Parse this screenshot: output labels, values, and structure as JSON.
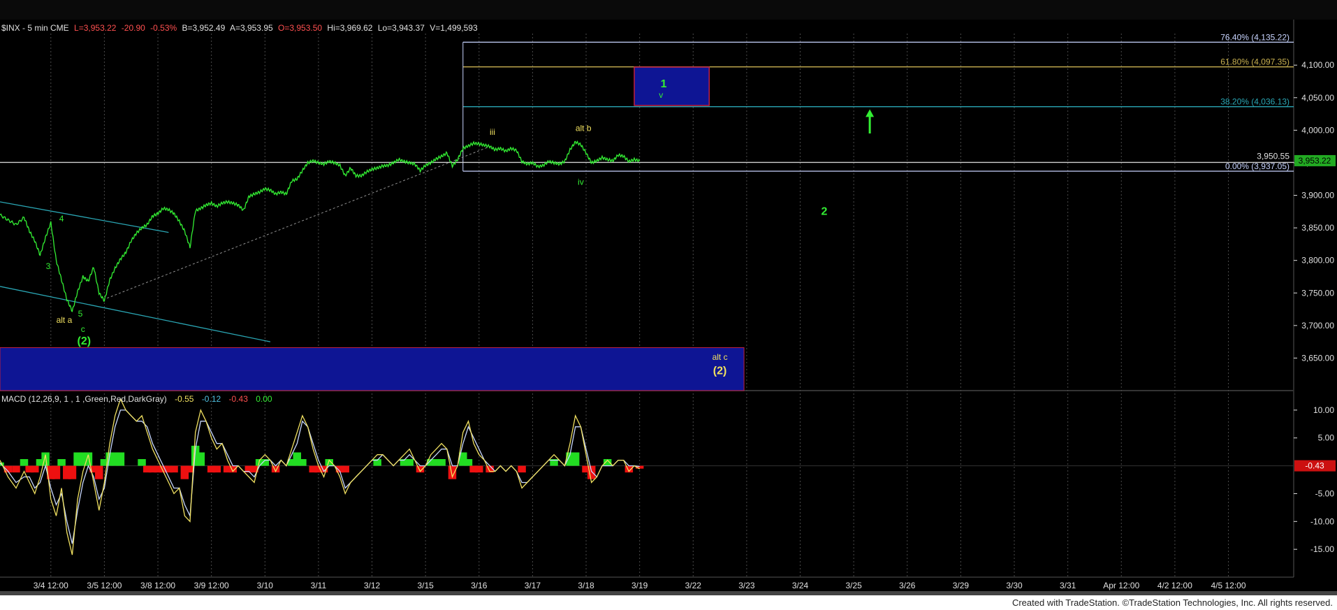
{
  "header": {
    "symbol": "$INX - 5 min  CME",
    "last": "L=3,953.22",
    "change": "-20.90",
    "pct": "-0.53%",
    "bid": "B=3,952.49",
    "ask": "A=3,953.95",
    "open": "O=3,953.50",
    "high": "Hi=3,969.62",
    "low": "Lo=3,943.37",
    "volume": "V=1,499,593"
  },
  "macd_header": {
    "name": "MACD (12,26,9, 1 , 1 ,Green,Red,DarkGray)",
    "v1": "-0.55",
    "v2": "-0.12",
    "v3": "-0.43",
    "v4": "0.00"
  },
  "footer": {
    "text": "Created with TradeStation. ©TradeStation Technologies, Inc. All rights reserved."
  },
  "colors": {
    "price": "#33ee33",
    "yellow": "#f0e060",
    "teal": "#2aa6b4",
    "navy": "#0e1594",
    "grid": "#4a4a4a",
    "axis": "#e0e0e0"
  },
  "chart_data": [
    {
      "type": "line",
      "title": "$INX - 5 min",
      "ylim": [
        3600,
        4170
      ],
      "y_ticks": [
        "4,100.00",
        "4,050.00",
        "4,000.00",
        "3,950.00",
        "3,900.00",
        "3,850.00",
        "3,800.00",
        "3,750.00",
        "3,700.00",
        "3,650.00"
      ],
      "y_tick_values": [
        4100,
        4050,
        4000,
        3950,
        3900,
        3850,
        3800,
        3750,
        3700,
        3650
      ],
      "x_ticks": [
        "3/4 12:00",
        "3/5 12:00",
        "3/8 12:00",
        "3/9 12:00",
        "3/10",
        "3/11",
        "3/12",
        "3/15",
        "3/16",
        "3/17",
        "3/18",
        "3/19",
        "3/22",
        "3/23",
        "3/24",
        "3/25",
        "3/26",
        "3/29",
        "3/30",
        "3/31",
        "Apr 12:00",
        "4/2 12:00",
        "4/5 12:00"
      ],
      "x_tick_pos": [
        0.5,
        1.5,
        2.5,
        3.5,
        4.5,
        5.5,
        6.5,
        7.5,
        8.5,
        9.5,
        10.5,
        11.5,
        12.5,
        13.5,
        14.5,
        15.5,
        16.5,
        17.5,
        18.5,
        19.5,
        20.5,
        21.5,
        22.5
      ],
      "x_domain": [
        -0.45,
        23.72
      ],
      "series": [
        {
          "x": [
            -0.45,
            -0.3,
            -0.15,
            0.0,
            0.1,
            0.2,
            0.3,
            0.4,
            0.5,
            0.6,
            0.7,
            0.8,
            0.9,
            1.0,
            1.1,
            1.2,
            1.3,
            1.4,
            1.5,
            1.6,
            1.7,
            1.8,
            1.9,
            2.0,
            2.1,
            2.2,
            2.3,
            2.4,
            2.5,
            2.6,
            2.7,
            2.8,
            2.9,
            3.0,
            3.1,
            3.2,
            3.3,
            3.4,
            3.5,
            3.6,
            3.7,
            3.8,
            3.9,
            4.0,
            4.1,
            4.2,
            4.3,
            4.4,
            4.5,
            4.6,
            4.7,
            4.8,
            4.9,
            5.0,
            5.1,
            5.2,
            5.3,
            5.4,
            5.5,
            5.6,
            5.7,
            5.8,
            5.9,
            6.0,
            6.1,
            6.2,
            6.3,
            6.4,
            6.5,
            6.6,
            6.7,
            6.8,
            6.9,
            7.0,
            7.1,
            7.2,
            7.3,
            7.4,
            7.5,
            7.6,
            7.7,
            7.8,
            7.9,
            8.0,
            8.1,
            8.2,
            8.3,
            8.4,
            8.5,
            8.6,
            8.7,
            8.8,
            8.9,
            9.0,
            9.1,
            9.2,
            9.3,
            9.4,
            9.5,
            9.6,
            9.7,
            9.8,
            9.9,
            10.0,
            10.1,
            10.2,
            10.3,
            10.4,
            10.5,
            10.6,
            10.7,
            10.8,
            10.9,
            11.0,
            11.1,
            11.2,
            11.3,
            11.4,
            11.5
          ],
          "y": [
            3870,
            3862,
            3855,
            3866,
            3845,
            3830,
            3808,
            3835,
            3858,
            3800,
            3770,
            3740,
            3722,
            3752,
            3775,
            3768,
            3790,
            3750,
            3738,
            3770,
            3788,
            3802,
            3812,
            3830,
            3842,
            3850,
            3855,
            3868,
            3872,
            3880,
            3878,
            3872,
            3860,
            3845,
            3820,
            3876,
            3880,
            3885,
            3888,
            3883,
            3888,
            3890,
            3888,
            3885,
            3877,
            3898,
            3902,
            3905,
            3910,
            3908,
            3902,
            3905,
            3902,
            3922,
            3925,
            3938,
            3950,
            3953,
            3950,
            3948,
            3952,
            3950,
            3946,
            3930,
            3942,
            3930,
            3930,
            3936,
            3940,
            3942,
            3945,
            3946,
            3950,
            3955,
            3952,
            3950,
            3948,
            3938,
            3946,
            3950,
            3956,
            3960,
            3965,
            3945,
            3955,
            3972,
            3976,
            3980,
            3979,
            3977,
            3975,
            3970,
            3972,
            3968,
            3972,
            3969,
            3952,
            3948,
            3950,
            3944,
            3946,
            3952,
            3950,
            3948,
            3952,
            3970,
            3982,
            3978,
            3965,
            3950,
            3953,
            3958,
            3955,
            3953,
            3962,
            3960,
            3952,
            3955,
            3953
          ],
          "color": "#33ee33"
        }
      ],
      "annotations": [
        {
          "text": "3",
          "x": 0.45,
          "y": 3787,
          "color": "#33ee33"
        },
        {
          "text": "4",
          "x": 0.7,
          "y": 3860,
          "color": "#33ee33"
        },
        {
          "text": "5",
          "x": 1.05,
          "y": 3714,
          "color": "#33ee33"
        },
        {
          "text": "alt a",
          "x": 0.75,
          "y": 3704,
          "color": "#f0e060"
        },
        {
          "text": "c",
          "x": 1.1,
          "y": 3690,
          "color": "#33ee33"
        },
        {
          "text": "(2)",
          "x": 1.12,
          "y": 3671,
          "color": "#33ee33"
        },
        {
          "text": "iii",
          "x": 8.75,
          "y": 3993,
          "color": "#f0e060"
        },
        {
          "text": "alt b",
          "x": 10.45,
          "y": 3999,
          "color": "#f0e060"
        },
        {
          "text": "iv",
          "x": 10.4,
          "y": 3916,
          "color": "#33ee33"
        },
        {
          "text": "1",
          "x": 11.95,
          "y": 4066,
          "color": "#33ee33"
        },
        {
          "text": "v",
          "x": 11.9,
          "y": 4050,
          "color": "#33ee33"
        },
        {
          "text": "2",
          "x": 14.95,
          "y": 3870,
          "color": "#33ee33"
        },
        {
          "text": "alt c",
          "x": 13.0,
          "y": 3647,
          "color": "#f0e060"
        },
        {
          "text": "(2)",
          "x": 13.0,
          "y": 3625,
          "color": "#f0e060"
        }
      ],
      "fib_levels": [
        {
          "text": "76.40% (4,135.22)",
          "value": 4135.22,
          "color": "#c8d4ff"
        },
        {
          "text": "61.80% (4,097.35)",
          "value": 4097.35,
          "color": "#c8b050"
        },
        {
          "text": "38.20% (4,036.13)",
          "value": 4036.13,
          "color": "#2aa6b4"
        },
        {
          "text": "0.00% (3,937.05)",
          "value": 3937.05,
          "color": "#c8d4ff"
        }
      ],
      "price_line": {
        "text": "3,950.55",
        "value": 3950.55
      },
      "last_price": {
        "text": "3,953.22",
        "value": 3953.22
      },
      "fib_start_x": 8.2,
      "target_box_top": {
        "x0": 11.4,
        "x1": 12.8,
        "y0": 4038,
        "y1": 4097
      },
      "target_box_bottom": {
        "x0": -0.45,
        "x1": 13.45,
        "y0": 3600,
        "y1": 3666
      },
      "up_arrow": {
        "x": 15.8,
        "y0": 3995,
        "y1": 4030
      },
      "trend_upper": {
        "x0": -0.45,
        "y0": 3890,
        "x1": 2.7,
        "y1": 3843
      },
      "trend_lower": {
        "x0": -0.45,
        "y0": 3760,
        "x1": 4.6,
        "y1": 3675
      },
      "dashed_line": {
        "x0": 1.55,
        "y0": 3742,
        "x1": 8.7,
        "y1": 3975
      }
    },
    {
      "type": "line",
      "title": "MACD (12,26,9, 1 , 1 ,Green,Red,DarkGray)",
      "ylim": [
        -20,
        13.5
      ],
      "y_ticks": [
        "10.00",
        "5.00",
        "",
        "-5.00",
        "-10.00",
        "-15.00"
      ],
      "y_tick_values": [
        10,
        5,
        0,
        -5,
        -10,
        -15
      ],
      "zero_label": "-0.43",
      "x": [
        -0.45,
        -0.3,
        -0.15,
        0.0,
        0.1,
        0.2,
        0.3,
        0.4,
        0.5,
        0.6,
        0.7,
        0.8,
        0.9,
        1.0,
        1.1,
        1.2,
        1.3,
        1.4,
        1.5,
        1.6,
        1.7,
        1.8,
        1.9,
        2.0,
        2.1,
        2.2,
        2.3,
        2.4,
        2.5,
        2.6,
        2.7,
        2.8,
        2.9,
        3.0,
        3.1,
        3.2,
        3.3,
        3.4,
        3.5,
        3.6,
        3.7,
        3.8,
        3.9,
        4.0,
        4.1,
        4.2,
        4.3,
        4.4,
        4.5,
        4.6,
        4.7,
        4.8,
        4.9,
        5.0,
        5.1,
        5.2,
        5.3,
        5.4,
        5.5,
        5.6,
        5.7,
        5.8,
        5.9,
        6.0,
        6.1,
        6.2,
        6.3,
        6.4,
        6.5,
        6.6,
        6.7,
        6.8,
        6.9,
        7.0,
        7.1,
        7.2,
        7.3,
        7.4,
        7.5,
        7.6,
        7.7,
        7.8,
        7.9,
        8.0,
        8.1,
        8.2,
        8.3,
        8.4,
        8.5,
        8.6,
        8.7,
        8.8,
        8.9,
        9.0,
        9.1,
        9.2,
        9.3,
        9.4,
        9.5,
        9.6,
        9.7,
        9.8,
        9.9,
        10.0,
        10.1,
        10.2,
        10.3,
        10.4,
        10.5,
        10.6,
        10.7,
        10.8,
        10.9,
        11.0,
        11.1,
        11.2,
        11.3,
        11.4,
        11.5
      ],
      "macd": [
        1,
        -2,
        -4,
        -1,
        -3,
        -5,
        -2,
        2,
        -6,
        -9,
        -4,
        -12,
        -16,
        -6,
        -1,
        2,
        -3,
        -8,
        -3,
        4,
        9,
        12,
        10,
        9,
        8,
        9,
        6,
        3,
        1,
        -1,
        -3,
        -5,
        -4,
        -9,
        -10,
        6,
        10,
        8,
        5,
        3,
        4,
        1,
        -1,
        0,
        -1,
        -2,
        -3,
        1,
        2,
        1,
        -1,
        1,
        0,
        3,
        6,
        9,
        7,
        3,
        0,
        -2,
        1,
        0,
        -2,
        -5,
        -3,
        -2,
        -1,
        0,
        1,
        2,
        2,
        1,
        0,
        1,
        2,
        3,
        1,
        -1,
        0,
        2,
        3,
        4,
        3,
        -2,
        0,
        6,
        8,
        4,
        2,
        1,
        -1,
        -1,
        0,
        -1,
        0,
        -1,
        -4,
        -3,
        -2,
        -1,
        0,
        1,
        2,
        1,
        0,
        4,
        9,
        7,
        2,
        -3,
        -2,
        0,
        1,
        0,
        1,
        1,
        -1,
        0,
        -0.55
      ],
      "signal": [
        0.5,
        -1,
        -3,
        -2,
        -2,
        -4,
        -3,
        0,
        -4,
        -7,
        -5,
        -10,
        -14,
        -8,
        -3,
        0,
        -2,
        -6,
        -4,
        2,
        7,
        10,
        10,
        9,
        8,
        8,
        7,
        4,
        2,
        0,
        -2,
        -4,
        -4,
        -7,
        -9,
        3,
        8,
        8,
        6,
        4,
        4,
        2,
        0,
        0,
        -1,
        -1,
        -2,
        0,
        1,
        1,
        0,
        1,
        0,
        2,
        4,
        8,
        7,
        4,
        1,
        -1,
        0,
        0,
        -1,
        -4,
        -3,
        -2,
        -1,
        0,
        1,
        1,
        2,
        1,
        0,
        1,
        1,
        2,
        1,
        0,
        0,
        1,
        2,
        3,
        3,
        0,
        0,
        4,
        7,
        5,
        3,
        1,
        0,
        -1,
        0,
        -1,
        0,
        -1,
        -3,
        -3,
        -2,
        -1,
        0,
        1,
        1,
        1,
        0,
        2,
        7,
        7,
        3,
        -1,
        -2,
        0,
        0,
        0,
        1,
        1,
        0,
        0,
        -0.12
      ],
      "series_colors": {
        "macd": "#f0e060",
        "signal": "#c8d8ff"
      }
    }
  ]
}
